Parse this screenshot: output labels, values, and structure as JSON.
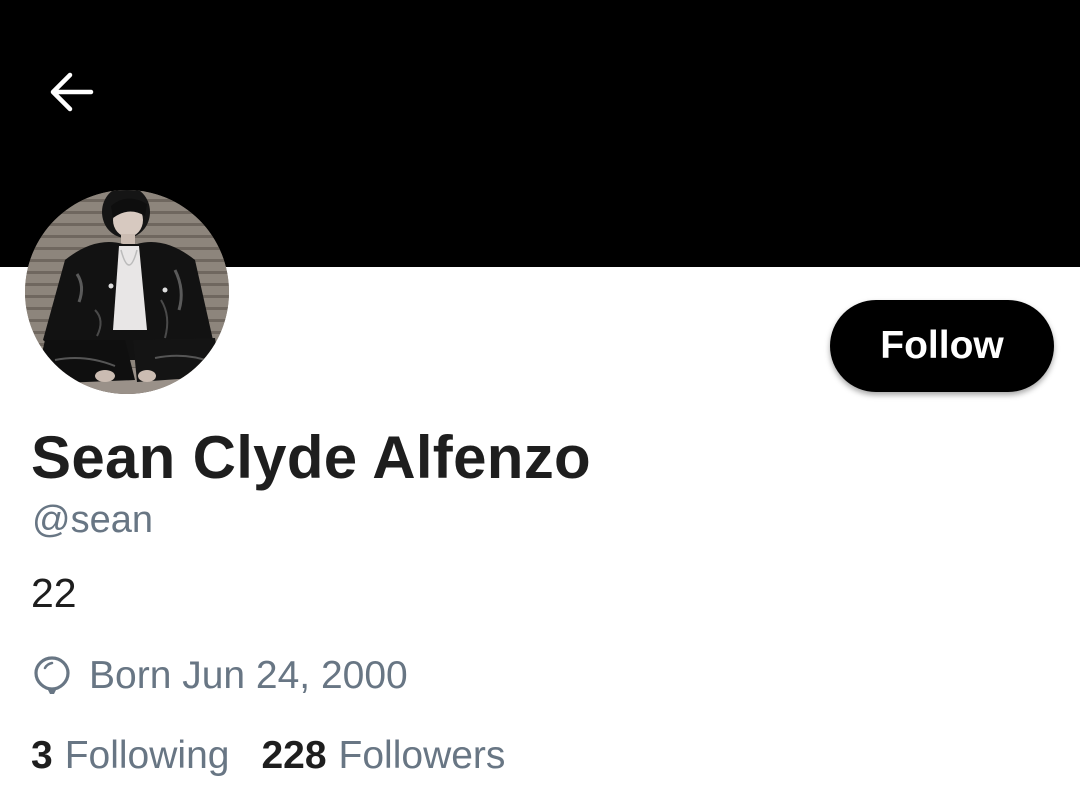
{
  "header": {
    "back_icon": "arrow-left-icon"
  },
  "profile": {
    "avatar_icon": "profile-photo",
    "display_name": "Sean Clyde Alfenzo",
    "handle": "@sean",
    "bio": "22",
    "birthday_icon": "balloon-icon",
    "birthday": "Born Jun 24, 2000"
  },
  "actions": {
    "follow_label": "Follow"
  },
  "stats": {
    "following_count": "3",
    "following_label": "Following",
    "followers_count": "228",
    "followers_label": "Followers"
  },
  "colors": {
    "banner": "#000000",
    "primary_text": "#1e1e1e",
    "secondary_text": "#687684",
    "button_bg": "#000000",
    "button_text": "#ffffff"
  }
}
